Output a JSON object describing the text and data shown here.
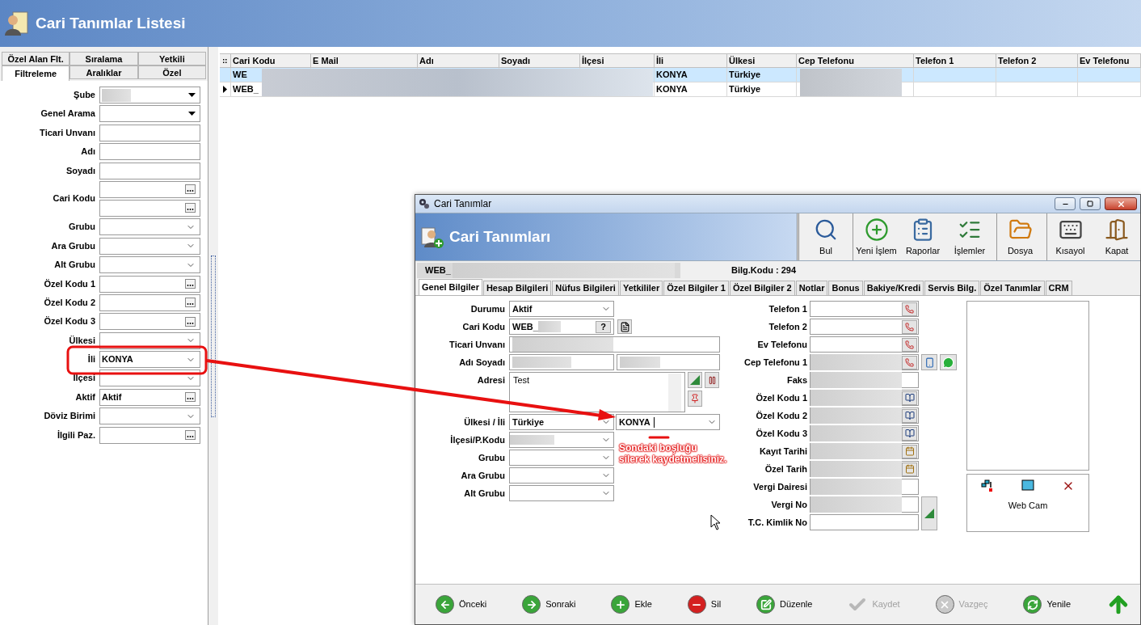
{
  "app": {
    "title": "Cari Tanımlar Listesi"
  },
  "filter_tab_rows": [
    {
      "tabs": [
        {
          "label": "Özel Alan Flt.",
          "selected": false
        },
        {
          "label": "Sıralama",
          "selected": false
        },
        {
          "label": "Yetkili",
          "selected": false
        }
      ]
    },
    {
      "tabs": [
        {
          "label": "Filtreleme",
          "selected": true
        },
        {
          "label": "Aralıklar",
          "selected": false
        },
        {
          "label": "Özel",
          "selected": false
        }
      ]
    }
  ],
  "filters": [
    {
      "label": "Şube",
      "fields": [
        {
          "kind": "dropdown",
          "redacted": true
        }
      ]
    },
    {
      "label": "Genel Arama",
      "fields": [
        {
          "kind": "dropdown"
        }
      ]
    },
    {
      "label": "Ticari Unvanı",
      "fields": [
        {
          "kind": "text"
        }
      ]
    },
    {
      "label": "Adı",
      "fields": [
        {
          "kind": "text"
        }
      ]
    },
    {
      "label": "Soyadı",
      "fields": [
        {
          "kind": "text"
        }
      ]
    },
    {
      "label": "Cari Kodu",
      "fields": [
        {
          "kind": "lookup"
        },
        {
          "kind": "lookup"
        }
      ]
    },
    {
      "label": "Grubu",
      "fields": [
        {
          "kind": "combo"
        }
      ]
    },
    {
      "label": "Ara Grubu",
      "fields": [
        {
          "kind": "combo"
        }
      ]
    },
    {
      "label": "Alt Grubu",
      "fields": [
        {
          "kind": "combo"
        }
      ]
    },
    {
      "label": "Özel Kodu 1",
      "fields": [
        {
          "kind": "lookup"
        }
      ]
    },
    {
      "label": "Özel Kodu 2",
      "fields": [
        {
          "kind": "lookup"
        }
      ]
    },
    {
      "label": "Özel Kodu 3",
      "fields": [
        {
          "kind": "lookup"
        }
      ]
    },
    {
      "label": "Ülkesi",
      "fields": [
        {
          "kind": "combo"
        }
      ]
    },
    {
      "label": "İli",
      "fields": [
        {
          "kind": "combo",
          "value": "KONYA"
        }
      ]
    },
    {
      "label": "İlçesi",
      "fields": [
        {
          "kind": "combo"
        }
      ]
    },
    {
      "label": "Aktif",
      "fields": [
        {
          "kind": "lookup",
          "value": "Aktif"
        }
      ]
    },
    {
      "label": "Döviz Birimi",
      "fields": [
        {
          "kind": "combo"
        }
      ]
    },
    {
      "label": "İlgili Paz.",
      "fields": [
        {
          "kind": "lookup"
        }
      ]
    }
  ],
  "grid": {
    "columns": [
      "Cari Kodu",
      "E Mail",
      "Adı",
      "Soyadı",
      "İlçesi",
      "İli",
      "Ülkesi",
      "Cep Telefonu",
      "Telefon 1",
      "Telefon 2",
      "Ev Telefonu"
    ],
    "rows": [
      {
        "selected": true,
        "current": false,
        "cells": [
          "WE",
          null,
          null,
          null,
          null,
          "KONYA",
          "Türkiye",
          null,
          null,
          null,
          null
        ]
      },
      {
        "selected": false,
        "current": true,
        "cells": [
          "WEB_",
          null,
          null,
          null,
          null,
          "KONYA",
          "Türkiye",
          null,
          null,
          null,
          null
        ]
      }
    ]
  },
  "dialog": {
    "title": "Cari Tanımlar",
    "banner_title": "Cari Tanımları",
    "toolbar": [
      {
        "label": "Bul",
        "kind": "find"
      },
      {
        "label": "Yeni İşlem",
        "kind": "add"
      },
      {
        "label": "Raporlar",
        "kind": "report"
      },
      {
        "label": "İşlemler",
        "kind": "list"
      },
      {
        "label": "Dosya",
        "kind": "file"
      },
      {
        "label": "Kısayol",
        "kind": "keyboard"
      },
      {
        "label": "Kapat",
        "kind": "exit"
      }
    ],
    "record_code": "WEB_",
    "info": "Bilg.Kodu : 294",
    "tabs": [
      {
        "label": "Genel Bilgiler",
        "selected": true
      },
      {
        "label": "Hesap Bilgileri",
        "selected": false
      },
      {
        "label": "Nüfus Bilgileri",
        "selected": false
      },
      {
        "label": "Yetkililer",
        "selected": false
      },
      {
        "label": "Özel Bilgiler 1",
        "selected": false
      },
      {
        "label": "Özel Bilgiler 2",
        "selected": false
      },
      {
        "label": "Notlar",
        "selected": false
      },
      {
        "label": "Bonus",
        "selected": false
      },
      {
        "label": "Bakiye/Kredi",
        "selected": false
      },
      {
        "label": "Servis Bilg.",
        "selected": false
      },
      {
        "label": "Özel Tanımlar",
        "selected": false
      },
      {
        "label": "CRM",
        "selected": false
      }
    ],
    "left_fields": [
      {
        "label": "Durumu",
        "kind": "status",
        "value": "Aktif"
      },
      {
        "label": "Cari Kodu",
        "kind": "code",
        "value": "WEB_",
        "button": "?"
      },
      {
        "label": "Ticari Unvanı",
        "kind": "wide"
      },
      {
        "label": "Adı Soyadı",
        "kind": "name"
      },
      {
        "label": "Adresi",
        "kind": "address",
        "value": "Test"
      },
      {
        "label": "Ülkesi / İli",
        "kind": "country",
        "value": "Türkiye",
        "value2": "KONYA"
      },
      {
        "label": "İlçesi/P.Kodu",
        "kind": "combo",
        "redacted": true
      },
      {
        "label": "Grubu",
        "kind": "combo"
      },
      {
        "label": "Ara Grubu",
        "kind": "combo"
      },
      {
        "label": "Alt Grubu",
        "kind": "combo"
      }
    ],
    "right_fields": [
      {
        "label": "Telefon 1",
        "kind": "phone"
      },
      {
        "label": "Telefon 2",
        "kind": "phone"
      },
      {
        "label": "Ev Telefonu",
        "kind": "phone"
      },
      {
        "label": "Cep Telefonu 1",
        "kind": "mobile",
        "redacted": true
      },
      {
        "label": "Faks",
        "kind": "text",
        "redacted": true
      },
      {
        "label": "Özel Kodu 1",
        "kind": "lookup",
        "redacted": true
      },
      {
        "label": "Özel Kodu 2",
        "kind": "lookup",
        "redacted": true
      },
      {
        "label": "Özel Kodu 3",
        "kind": "lookup",
        "redacted": true
      },
      {
        "label": "Kayıt Tarihi",
        "kind": "date",
        "redacted": true
      },
      {
        "label": "Özel Tarih",
        "kind": "date",
        "redacted": true
      },
      {
        "label": "Vergi Dairesi",
        "kind": "text",
        "redacted": true
      },
      {
        "label": "Vergi No",
        "kind": "taxno",
        "redacted": true
      },
      {
        "label": "T.C. Kimlik No",
        "kind": "text"
      }
    ],
    "webcam": {
      "label": "Web Cam"
    },
    "nav_buttons": [
      {
        "label": "Önceki",
        "kind": "prev",
        "disabled": false
      },
      {
        "label": "Sonraki",
        "kind": "next",
        "disabled": false
      },
      {
        "label": "Ekle",
        "kind": "add",
        "disabled": false
      },
      {
        "label": "Sil",
        "kind": "delete",
        "disabled": false
      },
      {
        "label": "Düzenle",
        "kind": "edit",
        "disabled": false
      },
      {
        "label": "Kaydet",
        "kind": "save",
        "disabled": true
      },
      {
        "label": "Vazgeç",
        "kind": "cancel",
        "disabled": true
      },
      {
        "label": "Yenile",
        "kind": "refresh",
        "disabled": false
      },
      {
        "kind": "up",
        "disabled": false
      }
    ]
  },
  "annotation": {
    "note": "Sondaki boşluğu silerek kaydetmelisiniz."
  }
}
